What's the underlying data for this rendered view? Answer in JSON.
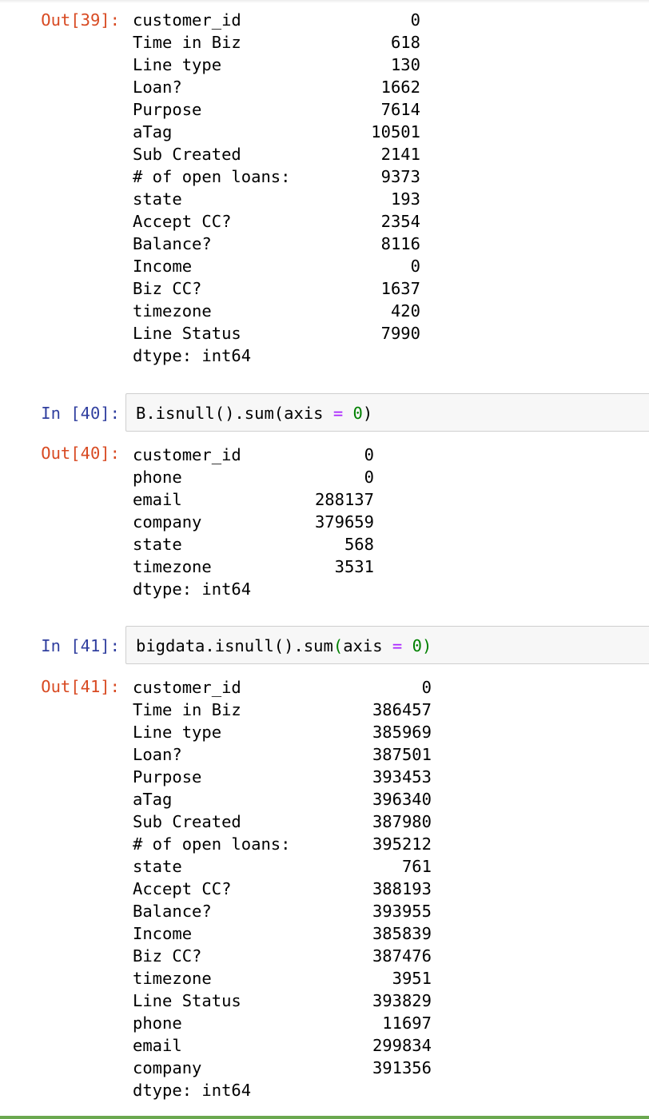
{
  "cells": {
    "out39": {
      "prompt": "Out[39]:",
      "rows": [
        {
          "key": "customer_id",
          "value": "0"
        },
        {
          "key": "Time in Biz",
          "value": "618"
        },
        {
          "key": "Line type",
          "value": "130"
        },
        {
          "key": "Loan?",
          "value": "1662"
        },
        {
          "key": "Purpose",
          "value": "7614"
        },
        {
          "key": "aTag",
          "value": "10501"
        },
        {
          "key": "Sub Created",
          "value": "2141"
        },
        {
          "key": "# of open loans:",
          "value": "9373"
        },
        {
          "key": "state",
          "value": "193"
        },
        {
          "key": "Accept CC?",
          "value": "2354"
        },
        {
          "key": "Balance?",
          "value": "8116"
        },
        {
          "key": "Income",
          "value": "0"
        },
        {
          "key": "Biz CC?",
          "value": "1637"
        },
        {
          "key": "timezone",
          "value": "420"
        },
        {
          "key": "Line Status",
          "value": "7990"
        }
      ],
      "dtype": "dtype: int64"
    },
    "in40": {
      "prompt": "In [40]:",
      "code": {
        "pre": "B.isnull().sum(axis ",
        "op": "=",
        "mid": " ",
        "num": "0",
        "post": ")"
      }
    },
    "out40": {
      "prompt": "Out[40]:",
      "rows": [
        {
          "key": "customer_id",
          "value": "0"
        },
        {
          "key": "phone",
          "value": "0"
        },
        {
          "key": "email",
          "value": "288137"
        },
        {
          "key": "company",
          "value": "379659"
        },
        {
          "key": "state",
          "value": "568"
        },
        {
          "key": "timezone",
          "value": "3531"
        }
      ],
      "dtype": "dtype: int64"
    },
    "in41": {
      "prompt": "In [41]:",
      "code": {
        "pre": "bigdata.isnull().sum",
        "open": "(",
        "arg": "axis ",
        "op": "=",
        "mid": " ",
        "num": "0",
        "close": ")"
      }
    },
    "out41": {
      "prompt": "Out[41]:",
      "rows": [
        {
          "key": "customer_id",
          "value": "0"
        },
        {
          "key": "Time in Biz",
          "value": "386457"
        },
        {
          "key": "Line type",
          "value": "385969"
        },
        {
          "key": "Loan?",
          "value": "387501"
        },
        {
          "key": "Purpose",
          "value": "393453"
        },
        {
          "key": "aTag",
          "value": "396340"
        },
        {
          "key": "Sub Created",
          "value": "387980"
        },
        {
          "key": "# of open loans:",
          "value": "395212"
        },
        {
          "key": "state",
          "value": "761"
        },
        {
          "key": "Accept CC?",
          "value": "388193"
        },
        {
          "key": "Balance?",
          "value": "393955"
        },
        {
          "key": "Income",
          "value": "385839"
        },
        {
          "key": "Biz CC?",
          "value": "387476"
        },
        {
          "key": "timezone",
          "value": "3951"
        },
        {
          "key": "Line Status",
          "value": "393829"
        },
        {
          "key": "phone",
          "value": "11697"
        },
        {
          "key": "email",
          "value": "299834"
        },
        {
          "key": "company",
          "value": "391356"
        }
      ],
      "dtype": "dtype: int64"
    }
  },
  "colors": {
    "out_prompt": "#d84a22",
    "in_prompt": "#303f9f",
    "operator": "#aa22ff",
    "number": "#008000",
    "cell_bg": "#f7f7f7",
    "cell_border": "#cfcfcf"
  }
}
